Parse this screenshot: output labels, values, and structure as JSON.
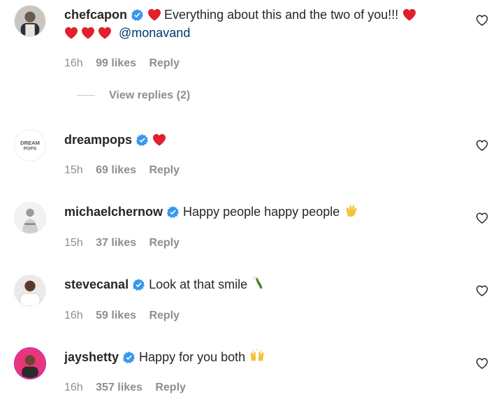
{
  "comments": [
    {
      "username": "chefcapon",
      "text": "Everything about this and the two of you!!!",
      "mention": "@monavand",
      "time": "16h",
      "likes": "99 likes",
      "reply_label": "Reply",
      "view_replies": "View replies (2)"
    },
    {
      "username": "dreampops",
      "avatar_text": "DREAM POPS",
      "time": "15h",
      "likes": "69 likes",
      "reply_label": "Reply"
    },
    {
      "username": "michaelchernow",
      "text": "Happy people happy people",
      "time": "15h",
      "likes": "37 likes",
      "reply_label": "Reply"
    },
    {
      "username": "stevecanal",
      "text": "Look at that smile",
      "time": "16h",
      "likes": "59 likes",
      "reply_label": "Reply"
    },
    {
      "username": "jayshetty",
      "text": "Happy for you both",
      "time": "16h",
      "likes": "357 likes",
      "reply_label": "Reply"
    }
  ],
  "colors": {
    "verified": "#3897f0",
    "heart": "#ed4956",
    "meta": "#8e8e8e",
    "mention": "#00376b"
  }
}
